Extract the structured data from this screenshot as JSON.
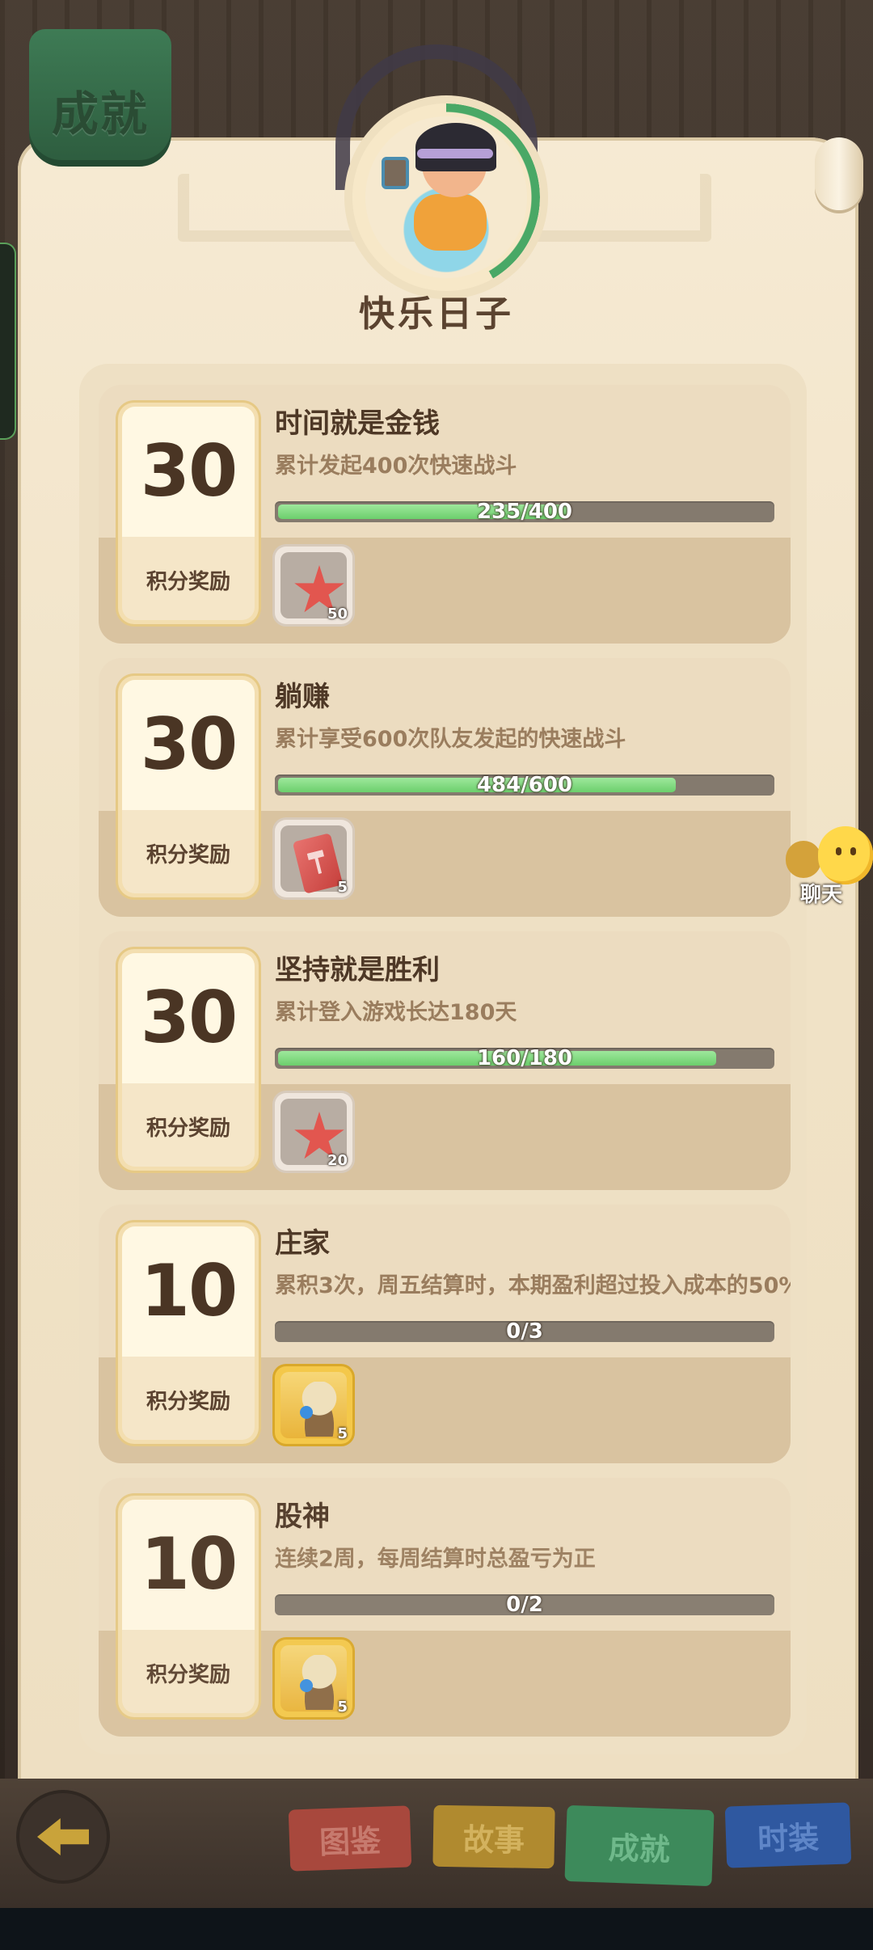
{
  "header": {
    "tab_title": "成就",
    "achievement_name": "快乐日子"
  },
  "achievements": [
    {
      "points": "30",
      "points_label": "积分奖励",
      "title": "时间就是金钱",
      "description": "累计发起400次快速战斗",
      "progress_text": "235/400",
      "progress": 0.5875,
      "reward": {
        "icon": "starfish-icon",
        "qty": "50"
      }
    },
    {
      "points": "30",
      "points_label": "积分奖励",
      "title": "躺赚",
      "description": "累计享受600次队友发起的快速战斗",
      "progress_text": "484/600",
      "progress": 0.8067,
      "reward": {
        "icon": "ticket-icon",
        "qty": "5"
      }
    },
    {
      "points": "30",
      "points_label": "积分奖励",
      "title": "坚持就是胜利",
      "description": "累计登入游戏长达180天",
      "progress_text": "160/180",
      "progress": 0.8889,
      "reward": {
        "icon": "starfish-icon",
        "qty": "20"
      }
    },
    {
      "points": "10",
      "points_label": "积分奖励",
      "title": "庄家",
      "description": "累积3次，周五结算时，本期盈利超过投入成本的50%",
      "progress_text": "0/3",
      "progress": 0,
      "reward": {
        "icon": "idol-icon",
        "qty": "5"
      }
    },
    {
      "points": "10",
      "points_label": "积分奖励",
      "title": "股神",
      "description": "连续2周，每周结算时总盈亏为正",
      "progress_text": "0/2",
      "progress": 0,
      "reward": {
        "icon": "idol-icon",
        "qty": "5"
      }
    }
  ],
  "chat": {
    "label": "聊天"
  },
  "bottom_nav": {
    "tabs": [
      {
        "label": "图鉴"
      },
      {
        "label": "故事"
      },
      {
        "label": "成就",
        "active": true
      },
      {
        "label": "时装"
      }
    ]
  },
  "colors": {
    "progress_fill": "#6ccf6c",
    "tab_active": "#3d8a5b",
    "tab_gallery": "#a8483d",
    "tab_story": "#b08a2f",
    "tab_costume": "#2f58a0"
  }
}
